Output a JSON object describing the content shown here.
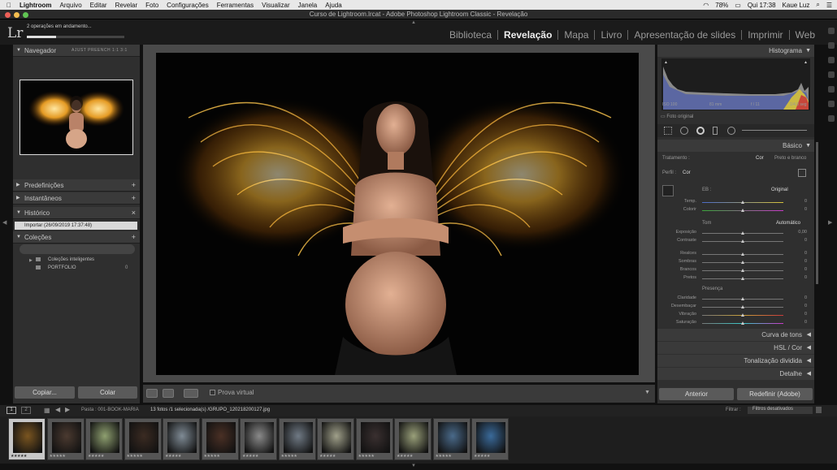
{
  "menubar": {
    "apple": "",
    "items": [
      "Lightroom",
      "Arquivo",
      "Editar",
      "Revelar",
      "Foto",
      "Configurações",
      "Ferramentas",
      "Visualizar",
      "Janela",
      "Ajuda"
    ],
    "battery": "78%",
    "clock": "Qui 17:38",
    "user": "Kaue Luz"
  },
  "window": {
    "title": "Curso de Lightroom.lrcat - Adobe Photoshop Lightroom Classic - Revelação"
  },
  "identity": {
    "logo": "Lr",
    "task_label": "2 operações em andamento...",
    "task_progress": 0.3
  },
  "modules": [
    "Biblioteca",
    "Revelação",
    "Mapa",
    "Livro",
    "Apresentação de slides",
    "Imprimir",
    "Web"
  ],
  "modules_active": "Revelação",
  "left_panel": {
    "navigator": {
      "title": "Navegador",
      "options": "AJUST  PREENCH  1:1  3:1"
    },
    "presets": "Predefinições",
    "snapshots": "Instantâneos",
    "history": {
      "title": "Histórico",
      "item": "Importar (26/09/2019 17:37:48)"
    },
    "collections": {
      "title": "Coleções",
      "items": [
        "Coleções inteligentes",
        "PORTFOLIO"
      ],
      "portfolio_count": "0"
    },
    "copy_button": "Copiar...",
    "paste_button": "Colar"
  },
  "toolbar": {
    "soft_proof": "Prova virtual"
  },
  "right_panel": {
    "histogram": {
      "title": "Histograma",
      "iso": "ISO 100",
      "focal": "81 mm",
      "aperture": "f / 11",
      "shutter": "1/4,0 seg",
      "original": "Foto original"
    },
    "basic": {
      "title": "Básico",
      "treatment_label": "Tratamento :",
      "treatment_color": "Cor",
      "treatment_bw": "Preto e branco",
      "profile_label": "Perfil :",
      "profile_value": "Cor",
      "wb_label": "EB :",
      "wb_value": "Original",
      "temp": {
        "label": "Temp.",
        "value": "0"
      },
      "tint": {
        "label": "Colorir",
        "value": "0"
      },
      "tone_label": "Tom",
      "tone_auto": "Automático",
      "exposure": {
        "label": "Exposição",
        "value": "0,00"
      },
      "contrast": {
        "label": "Contraste",
        "value": "0"
      },
      "highlights": {
        "label": "Realces",
        "value": "0"
      },
      "shadows": {
        "label": "Sombras",
        "value": "0"
      },
      "whites": {
        "label": "Brancos",
        "value": "0"
      },
      "blacks": {
        "label": "Pretos",
        "value": "0"
      },
      "presence_label": "Presença",
      "clarity": {
        "label": "Claridade",
        "value": "0"
      },
      "dehaze": {
        "label": "Desembaçar",
        "value": "0"
      },
      "vibrance": {
        "label": "Vibração",
        "value": "0"
      },
      "saturation": {
        "label": "Saturação",
        "value": "0"
      }
    },
    "tone_curve": "Curva de tons",
    "hsl": "HSL / Cor",
    "split_toning": "Tonalização dividida",
    "detail": "Detalhe",
    "previous_button": "Anterior",
    "reset_button": "Redefinir (Adobe)"
  },
  "filmstrip_bar": {
    "page1": "1",
    "page2": "2",
    "source": "Pasta : 001-BOOK-MARIA",
    "count": "13 fotos /1 selecionada(s) /GRUPO_120218200127.jpg",
    "filter_label": "Filtrar :",
    "filter_value": "Filtros desativados"
  },
  "filmstrip": {
    "thumbs": [
      {
        "stars": "★★★★★",
        "tone": "#7a5520"
      },
      {
        "stars": "★★★★★",
        "tone": "#4b3a30"
      },
      {
        "stars": "★★★★★",
        "tone": "#8fa070"
      },
      {
        "stars": "★★★★★",
        "tone": "#3b2b22"
      },
      {
        "stars": "★★★★★",
        "tone": "#7f8b95"
      },
      {
        "stars": "★★★★★",
        "tone": "#4a3025"
      },
      {
        "stars": "★★★★★",
        "tone": "#8a8a8a"
      },
      {
        "stars": "★★★★★",
        "tone": "#707a85"
      },
      {
        "stars": "★★★★★",
        "tone": "#a0a08a"
      },
      {
        "stars": "★★★★★",
        "tone": "#3a3030"
      },
      {
        "stars": "★★★★★",
        "tone": "#9aa07a"
      },
      {
        "stars": "★★★★★",
        "tone": "#4a6a8a"
      },
      {
        "stars": "★★★★★",
        "tone": "#3a6a9a"
      }
    ]
  },
  "colors": {
    "accent_active_module": "#eeeeee",
    "panel_bg": "#2f2f2f",
    "header_bg": "#3a3a3a"
  }
}
